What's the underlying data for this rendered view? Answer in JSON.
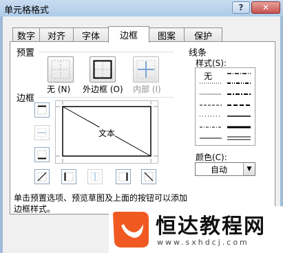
{
  "window": {
    "title": "单元格格式",
    "help_label": "?",
    "close_label": "✕"
  },
  "tabs": [
    {
      "label": "数字",
      "active": false
    },
    {
      "label": "对齐",
      "active": false
    },
    {
      "label": "字体",
      "active": false
    },
    {
      "label": "边框",
      "active": true
    },
    {
      "label": "图案",
      "active": false
    },
    {
      "label": "保护",
      "active": false
    }
  ],
  "presets": {
    "section_label": "预置",
    "items": [
      {
        "label": "无 (N)",
        "icon": "no-border-icon",
        "enabled": true
      },
      {
        "label": "外边框 (O)",
        "icon": "outline-border-icon",
        "enabled": true
      },
      {
        "label": "内部 (I)",
        "icon": "inside-border-icon",
        "enabled": false
      }
    ]
  },
  "border": {
    "section_label": "边框",
    "preview_text": "文本",
    "side_buttons": [
      {
        "icon": "top-border-icon",
        "enabled": true
      },
      {
        "icon": "inside-horizontal-border-icon",
        "enabled": false
      },
      {
        "icon": "bottom-border-icon",
        "enabled": true
      }
    ],
    "bottom_buttons": [
      {
        "icon": "diagonal-up-border-icon",
        "enabled": true
      },
      {
        "icon": "left-border-icon",
        "enabled": true
      },
      {
        "icon": "inside-vertical-border-icon",
        "enabled": false
      },
      {
        "icon": "right-border-icon",
        "enabled": true
      },
      {
        "icon": "diagonal-down-border-icon",
        "enabled": true
      }
    ]
  },
  "line": {
    "section_label": "线条",
    "style_label": "样式(S):",
    "none_label": "无",
    "color_label": "颜色(C):",
    "color_value": "自动"
  },
  "hint": "单击预置选项、预览草图及上面的按钮可以添加边框样式。",
  "watermark": {
    "brand": "恒达教程网",
    "url": "www.sxhdcj.com",
    "logo_color": "#f05a22"
  }
}
